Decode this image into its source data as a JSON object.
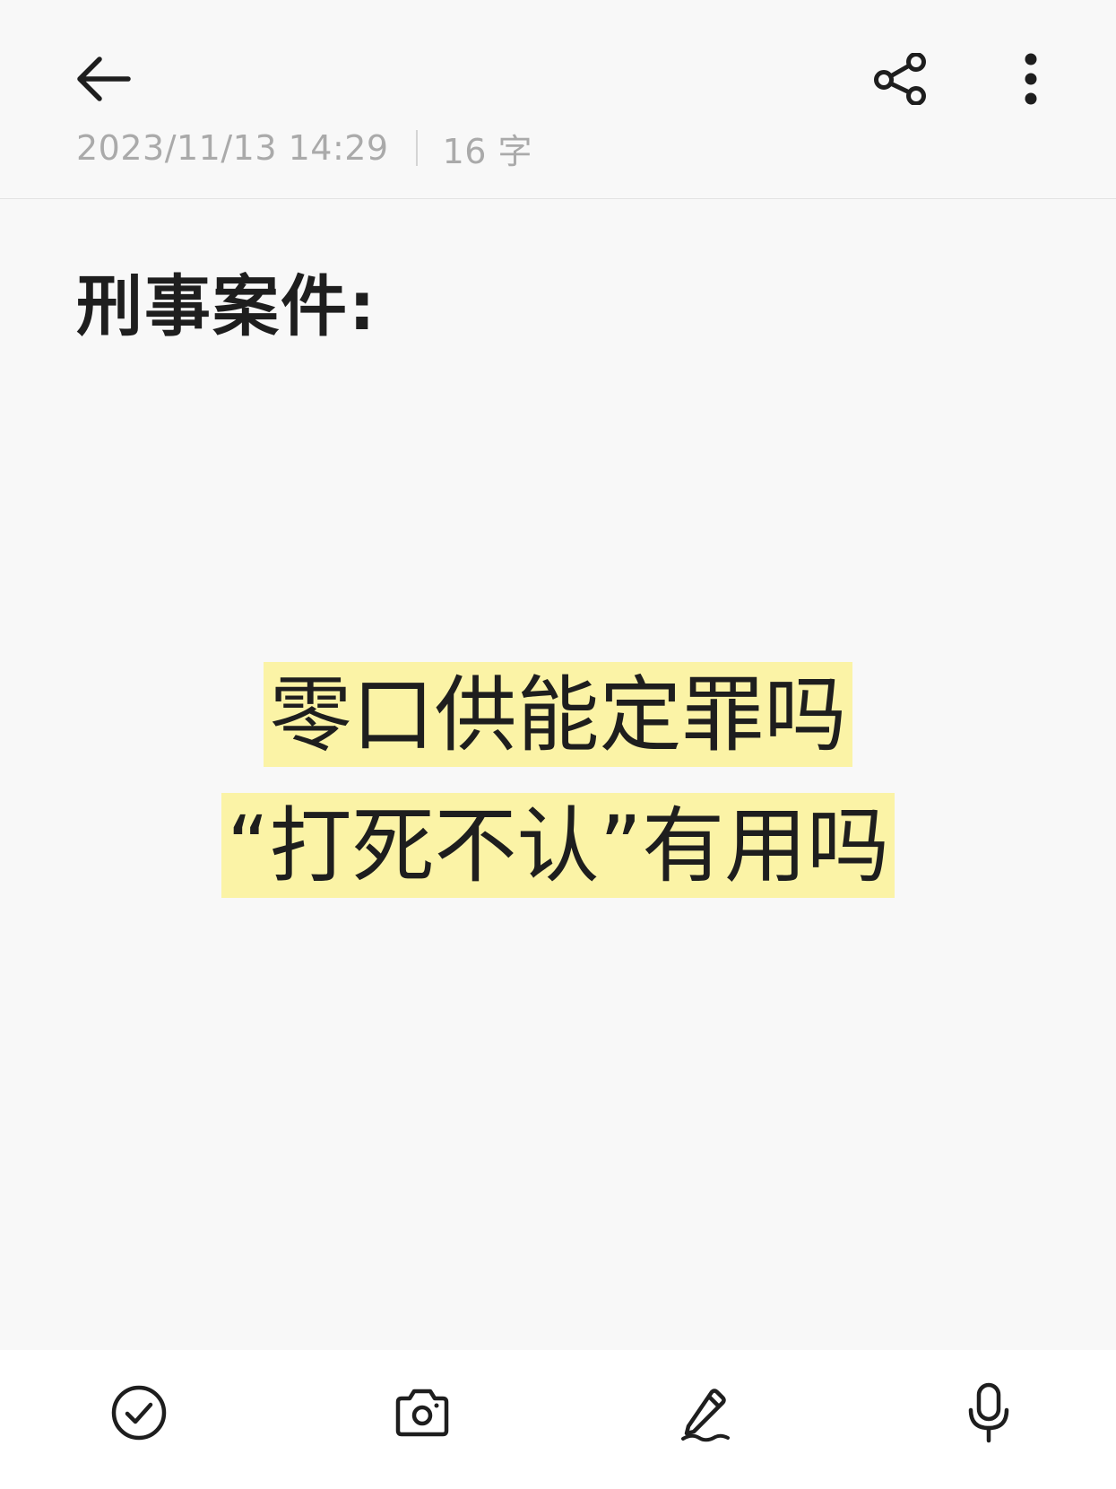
{
  "header": {
    "back_icon": "arrow-left-icon",
    "share_icon": "share-icon",
    "more_icon": "more-vertical-icon",
    "timestamp": "2023/11/13 14:29",
    "word_count": "16 字"
  },
  "note": {
    "title": "刑事案件:",
    "highlighted_lines": [
      "零口供能定罪吗",
      "“打死不认”有用吗"
    ],
    "highlight_color": "#fbf3a6"
  },
  "toolbar": {
    "items": [
      {
        "icon": "checklist-icon"
      },
      {
        "icon": "camera-icon"
      },
      {
        "icon": "handwriting-pen-icon"
      },
      {
        "icon": "microphone-icon"
      }
    ]
  }
}
